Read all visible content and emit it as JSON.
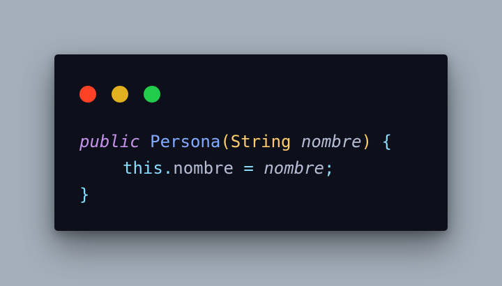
{
  "window": {
    "controls": [
      {
        "name": "close",
        "color": "#ff4126"
      },
      {
        "name": "minimize",
        "color": "#e1b01f"
      },
      {
        "name": "maximize",
        "color": "#21cb4c"
      }
    ]
  },
  "code": {
    "language": "java",
    "colors": {
      "keyword": "#c792ea",
      "function": "#82aaff",
      "paren": "#ffcb6b",
      "type": "#ffcb6b",
      "parameter": "#b6bdd6",
      "brace": "#89ddff",
      "this": "#89ddff",
      "property": "#b6bdd6",
      "operator": "#89ddff",
      "punctuation": "#89ddff"
    },
    "line1": {
      "keyword": "public",
      "name": "Persona",
      "open_paren": "(",
      "type": "String",
      "param": "nombre",
      "close_paren": ")",
      "brace": "{"
    },
    "line2": {
      "this": "this",
      "dot": ".",
      "property": "nombre",
      "operator": "=",
      "value": "nombre",
      "semicolon": ";"
    },
    "line3": {
      "brace": "}"
    }
  }
}
